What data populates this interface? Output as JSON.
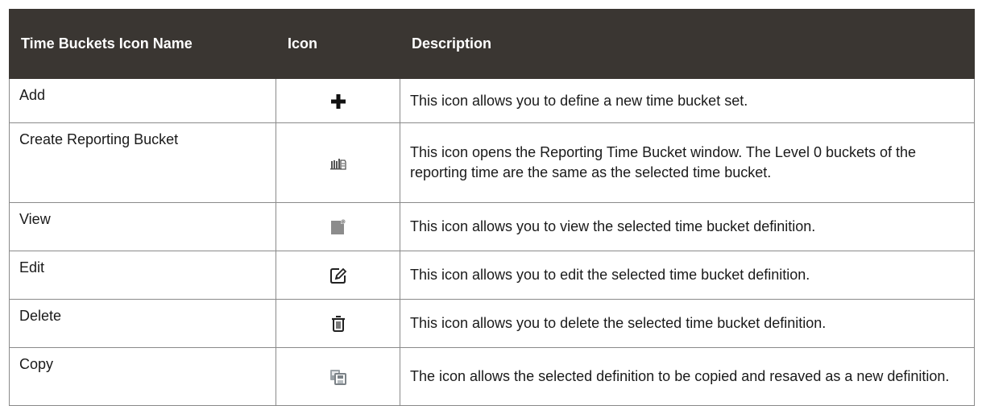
{
  "table": {
    "headers": {
      "name": "Time Buckets Icon Name",
      "icon": "Icon",
      "description": "Description"
    },
    "rows": [
      {
        "name": "Add",
        "icon": "plus-icon",
        "description": "This icon allows you to define a new time bucket set."
      },
      {
        "name": "Create Reporting Bucket",
        "icon": "reporting-bucket-icon",
        "description": "This icon opens the Reporting Time Bucket window. The Level 0 buckets of the reporting time are the same as the selected time bucket."
      },
      {
        "name": "View",
        "icon": "view-document-icon",
        "description": "This icon allows you to view the selected time bucket definition."
      },
      {
        "name": "Edit",
        "icon": "edit-pencil-icon",
        "description": "This icon allows you to edit the selected time bucket definition."
      },
      {
        "name": "Delete",
        "icon": "trash-icon",
        "description": "This icon allows you to delete the selected time bucket definition."
      },
      {
        "name": "Copy",
        "icon": "copy-icon",
        "description": "The icon allows the selected definition to be copied and resaved as a new definition."
      }
    ]
  },
  "colors": {
    "header_bg": "#3a3632",
    "header_text": "#ffffff",
    "border": "#8a8a8a"
  }
}
